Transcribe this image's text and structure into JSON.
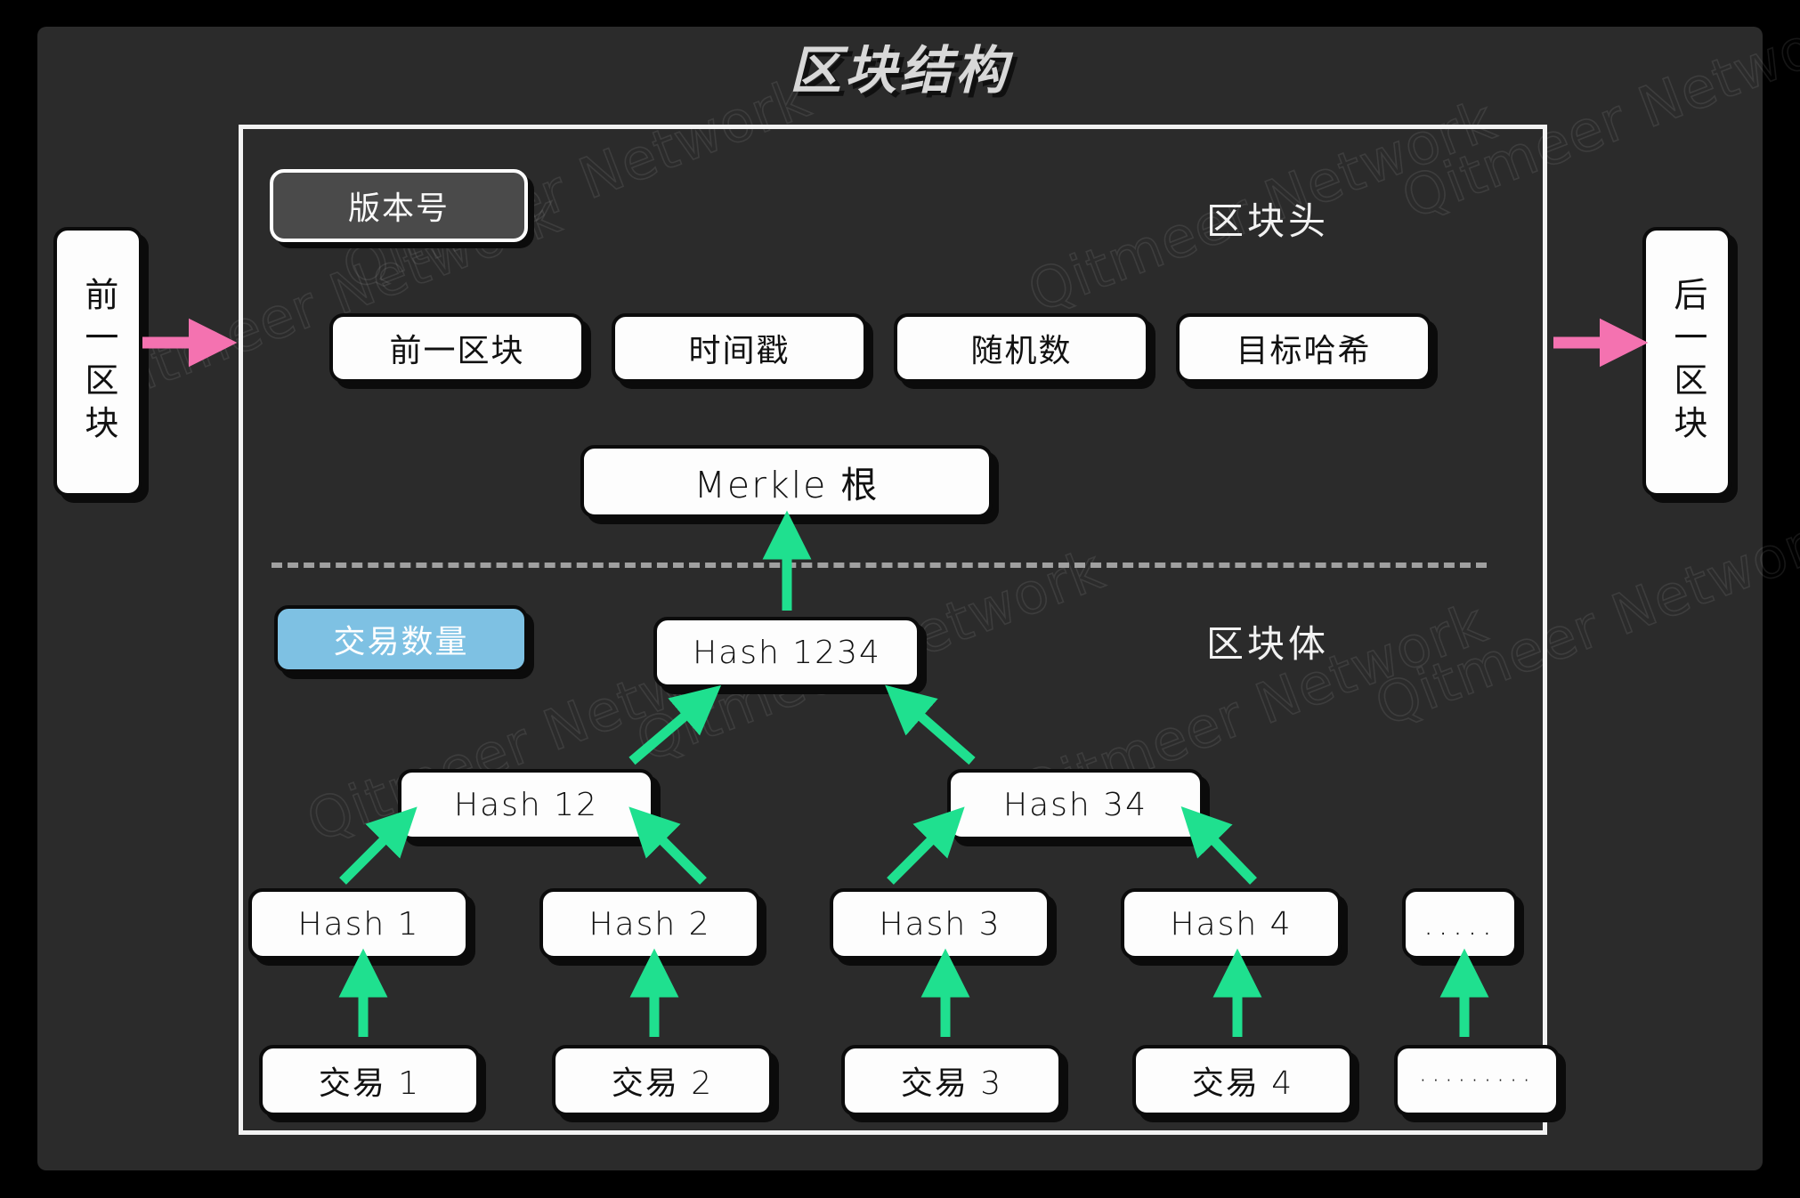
{
  "title": "区块结构",
  "watermark": {
    "text": "Qitmeer Network"
  },
  "colors": {
    "background": "#000000",
    "card": "#2b2b2b",
    "box_fill": "#fdfdfd",
    "box_border": "#0b0b0b",
    "version_box_fill": "#4a4a4a",
    "tx_count_fill": "#7ec1e3",
    "arrow_green": "#1fe08f",
    "arrow_pink": "#f472b0",
    "divider": "#a0a0a0",
    "frame": "#f2f2f2",
    "title_text": "#d8d8d8"
  },
  "chain": {
    "previous_block": "前一区块",
    "next_block": "后一区块"
  },
  "header": {
    "label": "区块头",
    "version": "版本号",
    "fields": [
      {
        "label": "前一区块"
      },
      {
        "label": "时间戳"
      },
      {
        "label": "随机数"
      },
      {
        "label": "目标哈希"
      }
    ],
    "merkle_root": "Merkle 根"
  },
  "body": {
    "label": "区块体",
    "tx_count": "交易数量",
    "level_1": [
      {
        "label": "Hash 1234"
      }
    ],
    "level_2": [
      {
        "label": "Hash 12"
      },
      {
        "label": "Hash 34"
      }
    ],
    "level_3": [
      {
        "label": "Hash 1"
      },
      {
        "label": "Hash 2"
      },
      {
        "label": "Hash 3"
      },
      {
        "label": "Hash 4"
      },
      {
        "label": "....."
      }
    ],
    "transactions": [
      {
        "label": "交易 1"
      },
      {
        "label": "交易 2"
      },
      {
        "label": "交易 3"
      },
      {
        "label": "交易 4"
      },
      {
        "label": "·········"
      }
    ]
  }
}
